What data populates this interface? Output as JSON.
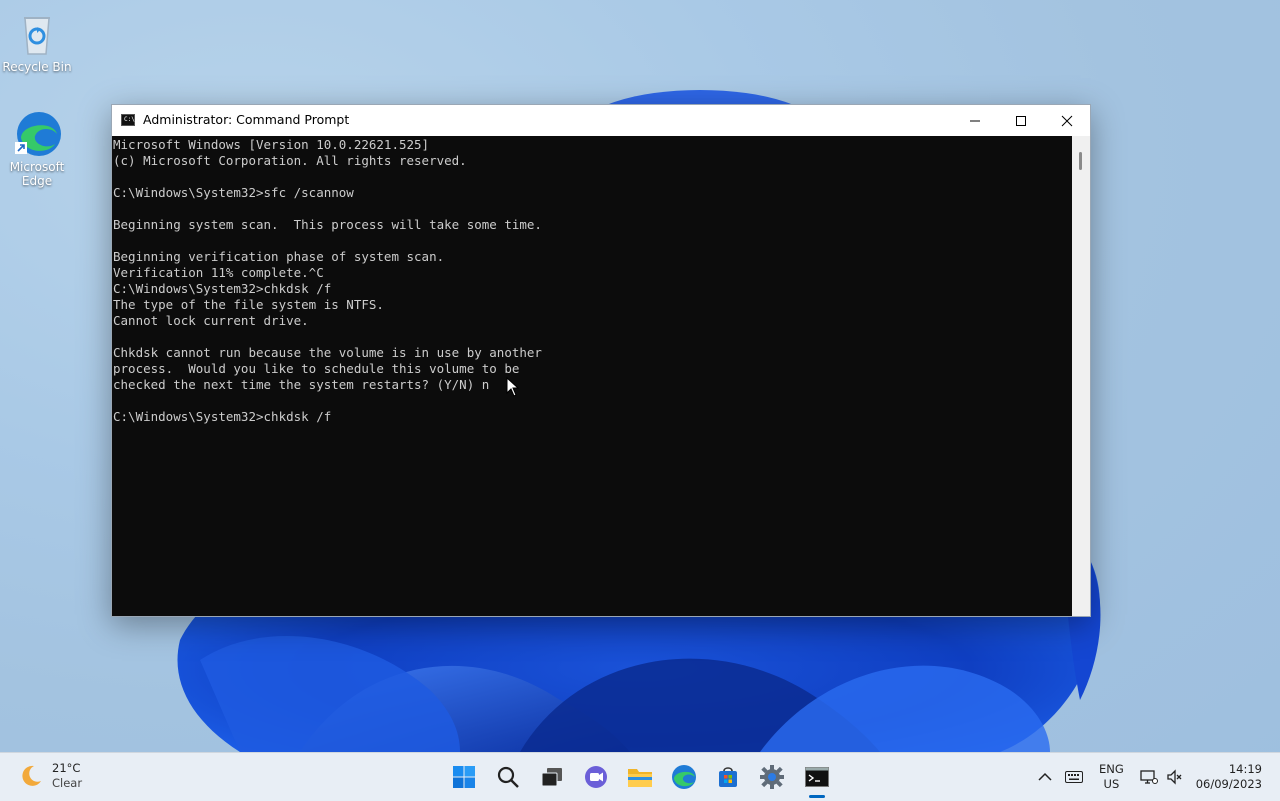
{
  "desktop": {
    "icons": [
      {
        "label": "Recycle Bin"
      },
      {
        "label": "Microsoft Edge"
      }
    ]
  },
  "window": {
    "title": "Administrator: Command Prompt",
    "console_icon_text": "C:\\",
    "lines": [
      "Microsoft Windows [Version 10.0.22621.525]",
      "(c) Microsoft Corporation. All rights reserved.",
      "",
      "C:\\Windows\\System32>sfc /scannow",
      "",
      "Beginning system scan.  This process will take some time.",
      "",
      "Beginning verification phase of system scan.",
      "Verification 11% complete.^C",
      "C:\\Windows\\System32>chkdsk /f",
      "The type of the file system is NTFS.",
      "Cannot lock current drive.",
      "",
      "Chkdsk cannot run because the volume is in use by another",
      "process.  Would you like to schedule this volume to be",
      "checked the next time the system restarts? (Y/N) n",
      "",
      "C:\\Windows\\System32>chkdsk /f"
    ]
  },
  "taskbar": {
    "weather": {
      "temp": "21°C",
      "condition": "Clear"
    },
    "apps": [
      "start",
      "search",
      "task-view",
      "chat",
      "file-explorer",
      "edge",
      "store",
      "settings",
      "command-prompt"
    ],
    "language": {
      "lang": "ENG",
      "region": "US"
    },
    "clock": {
      "time": "14:19",
      "date": "06/09/2023"
    }
  },
  "colors": {
    "accent": "#0067c0",
    "console_bg": "#0c0c0c",
    "console_fg": "#cccccc"
  }
}
